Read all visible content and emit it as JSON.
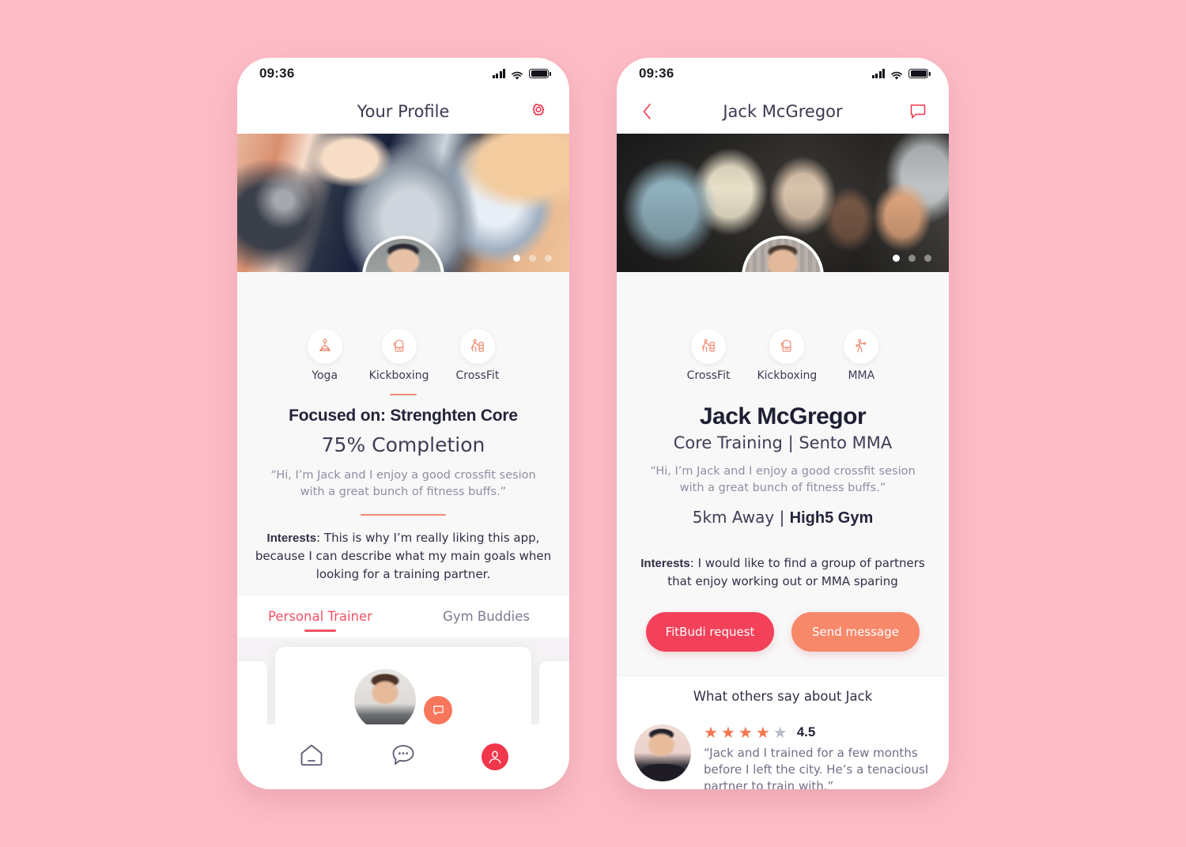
{
  "background_color": "#fcbcc6",
  "accent": {
    "red": "#f2364b",
    "coral": "#f7886a",
    "salmon": "#f08a70",
    "tab_active": "#f25365",
    "btn_primary": "#f4415a",
    "btn_secondary": "#f7886a",
    "star": "#f5764f",
    "star_off": "#b9bcc9"
  },
  "status_bar": {
    "time": "09:36",
    "signal_icon": "cellular-signal-icon",
    "wifi_icon": "wifi-icon",
    "battery_icon": "battery-full-icon"
  },
  "left_phone": {
    "nav": {
      "title": "Your Profile",
      "settings_icon": "gear-icon"
    },
    "hero": {
      "image_alt": "dumbbell-workout-photo",
      "dots": [
        true,
        false,
        false
      ]
    },
    "avatar_alt": "your-profile-avatar",
    "interests": [
      {
        "label": "Yoga",
        "icon": "yoga-icon"
      },
      {
        "label": "Kickboxing",
        "icon": "boxing-glove-icon"
      },
      {
        "label": "CrossFit",
        "icon": "crossfit-icon"
      }
    ],
    "focused_on": "Focused on: Strenghten Core",
    "completion": "75% Completion",
    "bio": "“Hi, I’m Jack and I enjoy a good crossfit sesion with a great bunch of fitness buffs.”",
    "interests_label": "Interests",
    "interests_text": ": This is why I’m really liking this app, because I can describe what my main goals when looking for a training partner.",
    "tabs": [
      {
        "label": "Personal Trainer",
        "active": true
      },
      {
        "label": "Gym Buddies",
        "active": false
      }
    ],
    "buddy_card": {
      "avatar_alt": "gym-buddy-avatar",
      "chat_icon": "chat-bubble-icon"
    },
    "bottom_nav": [
      {
        "name": "home",
        "icon": "home-icon",
        "active": false
      },
      {
        "name": "messages",
        "icon": "chat-dots-icon",
        "active": false
      },
      {
        "name": "profile",
        "icon": "person-icon",
        "active": true
      }
    ]
  },
  "right_phone": {
    "nav": {
      "back_icon": "chevron-left-icon",
      "title": "Jack McGregor",
      "message_icon": "chat-bubble-outline-icon"
    },
    "hero": {
      "image_alt": "gym-class-group-photo",
      "dots": [
        true,
        false,
        false
      ]
    },
    "avatar_alt": "jack-mcgregor-avatar",
    "interests": [
      {
        "label": "CrossFit",
        "icon": "crossfit-icon"
      },
      {
        "label": "Kickboxing",
        "icon": "boxing-glove-icon"
      },
      {
        "label": "MMA",
        "icon": "mma-fighter-icon"
      }
    ],
    "name": "Jack McGregor",
    "subtitle": "Core Training | Sento MMA",
    "bio": "“Hi, I’m Jack and I enjoy a good crossfit sesion with a great bunch of fitness buffs.”",
    "distance_prefix": "5km Away | ",
    "gym": "High5 Gym",
    "interests_label": "Interests",
    "interests_text": ": I would like to find a group of partners that enjoy working out or MMA sparing",
    "buttons": {
      "primary": "FitBudi request",
      "secondary": "Send message"
    },
    "reviews_heading": "What others say about Jack",
    "review": {
      "avatar_alt": "reviewer-avatar",
      "stars_filled": 4,
      "stars_total": 5,
      "rating": "4.5",
      "line1": "“Jack and I trained for a few months",
      "line2": "before I left the city. He’s a tenaciousI",
      "line3": "partner to train with.”"
    }
  }
}
